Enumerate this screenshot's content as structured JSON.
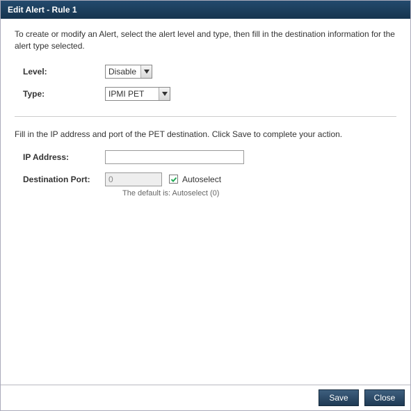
{
  "titlebar": "Edit Alert - Rule 1",
  "instructions": "To create or modify an Alert, select the alert level and type, then fill in the destination information for the alert type selected.",
  "fields": {
    "level": {
      "label": "Level:",
      "value": "Disable"
    },
    "type": {
      "label": "Type:",
      "value": "IPMI PET"
    }
  },
  "pet_section": {
    "instructions": "Fill in the IP address and port of the PET destination. Click Save to complete your action.",
    "ip": {
      "label": "IP Address:",
      "value": ""
    },
    "port": {
      "label": "Destination Port:",
      "value": "0",
      "placeholder": "0"
    },
    "autoselect": {
      "label": "Autoselect",
      "checked": true
    },
    "hint": "The default is: Autoselect (0)"
  },
  "buttons": {
    "save": "Save",
    "close": "Close"
  }
}
